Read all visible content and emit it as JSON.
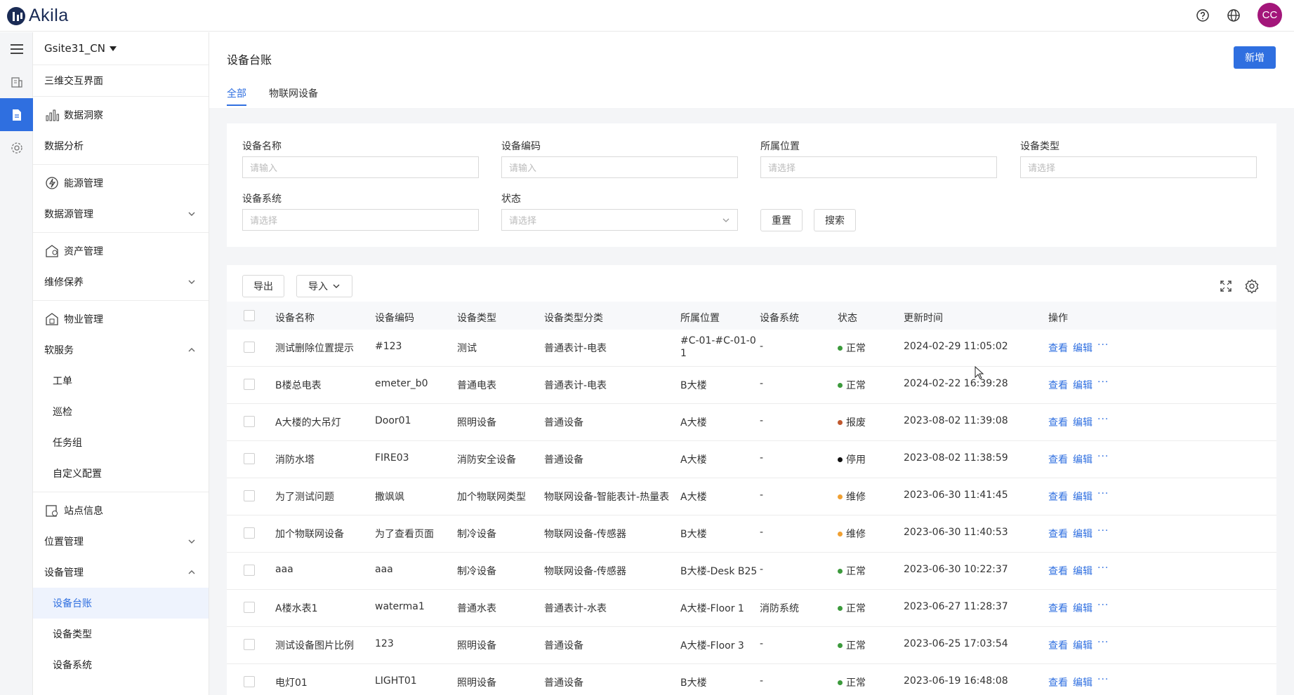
{
  "app": {
    "name": "Akila",
    "avatar_initials": "CC"
  },
  "site_selector": {
    "label": "Gsite31_CN"
  },
  "sidebar": {
    "items": [
      {
        "label": "三维交互界面"
      },
      {
        "label": "数据洞察"
      },
      {
        "label": "数据分析"
      },
      {
        "label": "能源管理"
      },
      {
        "label": "数据源管理"
      },
      {
        "label": "资产管理"
      },
      {
        "label": "维修保养"
      },
      {
        "label": "物业管理"
      },
      {
        "label": "软服务"
      },
      {
        "label": "工单"
      },
      {
        "label": "巡检"
      },
      {
        "label": "任务组"
      },
      {
        "label": "自定义配置"
      },
      {
        "label": "站点信息"
      },
      {
        "label": "位置管理"
      },
      {
        "label": "设备管理"
      },
      {
        "label": "设备台账"
      },
      {
        "label": "设备类型"
      },
      {
        "label": "设备系统"
      }
    ]
  },
  "page": {
    "title": "设备台账",
    "new_button": "新增",
    "tabs": [
      {
        "label": "全部"
      },
      {
        "label": "物联网设备"
      }
    ]
  },
  "filters": {
    "name": {
      "label": "设备名称",
      "placeholder": "请输入"
    },
    "code": {
      "label": "设备编码",
      "placeholder": "请输入"
    },
    "location": {
      "label": "所属位置",
      "placeholder": "请选择"
    },
    "type": {
      "label": "设备类型",
      "placeholder": "请选择"
    },
    "system": {
      "label": "设备系统",
      "placeholder": "请选择"
    },
    "status": {
      "label": "状态",
      "placeholder": "请选择"
    },
    "reset": "重置",
    "search": "搜索"
  },
  "toolbar": {
    "export": "导出",
    "import": "导入"
  },
  "table": {
    "columns": [
      "设备名称",
      "设备编码",
      "设备类型",
      "设备类型分类",
      "所属位置",
      "设备系统",
      "状态",
      "更新时间",
      "操作"
    ],
    "actions": {
      "view": "查看",
      "edit": "编辑",
      "more": "···"
    },
    "rows": [
      {
        "name": "测试删除位置提示",
        "code": "#123",
        "type": "测试",
        "category": "普通表计-电表",
        "location_l1": "#C-01-#C-01-0",
        "location_l2": "1",
        "system": "-",
        "status": "正常",
        "status_color": "#3c9a3c",
        "updated": "2024-02-29 11:05:02"
      },
      {
        "name": "B楼总电表",
        "code": "emeter_b0",
        "type": "普通电表",
        "category": "普通表计-电表",
        "location_l1": "B大楼",
        "location_l2": "",
        "system": "-",
        "status": "正常",
        "status_color": "#3c9a3c",
        "updated": "2024-02-22 16:39:28"
      },
      {
        "name": "A大楼的大吊灯",
        "code": "Door01",
        "type": "照明设备",
        "category": "普通设备",
        "location_l1": "A大楼",
        "location_l2": "",
        "system": "-",
        "status": "报废",
        "status_color": "#c0582e",
        "updated": "2023-08-02 11:39:08"
      },
      {
        "name": "消防水塔",
        "code": "FIRE03",
        "type": "消防安全设备",
        "category": "普通设备",
        "location_l1": "A大楼",
        "location_l2": "",
        "system": "-",
        "status": "停用",
        "status_color": "#111111",
        "updated": "2023-08-02 11:38:59"
      },
      {
        "name": "为了测试问题",
        "code": "撒飒飒",
        "type": "加个物联网类型",
        "category": "物联网设备-智能表计-热量表",
        "location_l1": "A大楼",
        "location_l2": "",
        "system": "-",
        "status": "维修",
        "status_color": "#f0a032",
        "updated": "2023-06-30 11:41:45"
      },
      {
        "name": "加个物联网设备",
        "code": "为了查看页面",
        "type": "制冷设备",
        "category": "物联网设备-传感器",
        "location_l1": "B大楼",
        "location_l2": "",
        "system": "-",
        "status": "维修",
        "status_color": "#f0a032",
        "updated": "2023-06-30 11:40:53"
      },
      {
        "name": "aaa",
        "code": "aaa",
        "type": "制冷设备",
        "category": "物联网设备-传感器",
        "location_l1": "B大楼-Desk B25",
        "location_l2": "",
        "system": "-",
        "status": "正常",
        "status_color": "#3c9a3c",
        "updated": "2023-06-30 10:22:37"
      },
      {
        "name": "A楼水表1",
        "code": "waterma1",
        "type": "普通水表",
        "category": "普通表计-水表",
        "location_l1": "A大楼-Floor 1",
        "location_l2": "",
        "system": "消防系统",
        "status": "正常",
        "status_color": "#3c9a3c",
        "updated": "2023-06-27 11:28:37"
      },
      {
        "name": "测试设备图片比例",
        "code": "123",
        "type": "照明设备",
        "category": "普通设备",
        "location_l1": "A大楼-Floor 3",
        "location_l2": "",
        "system": "-",
        "status": "正常",
        "status_color": "#3c9a3c",
        "updated": "2023-06-25 17:03:54"
      },
      {
        "name": "电灯01",
        "code": "LIGHT01",
        "type": "照明设备",
        "category": "普通设备",
        "location_l1": "B大楼",
        "location_l2": "",
        "system": "-",
        "status": "正常",
        "status_color": "#3c9a3c",
        "updated": "2023-06-19 16:48:08"
      }
    ]
  }
}
